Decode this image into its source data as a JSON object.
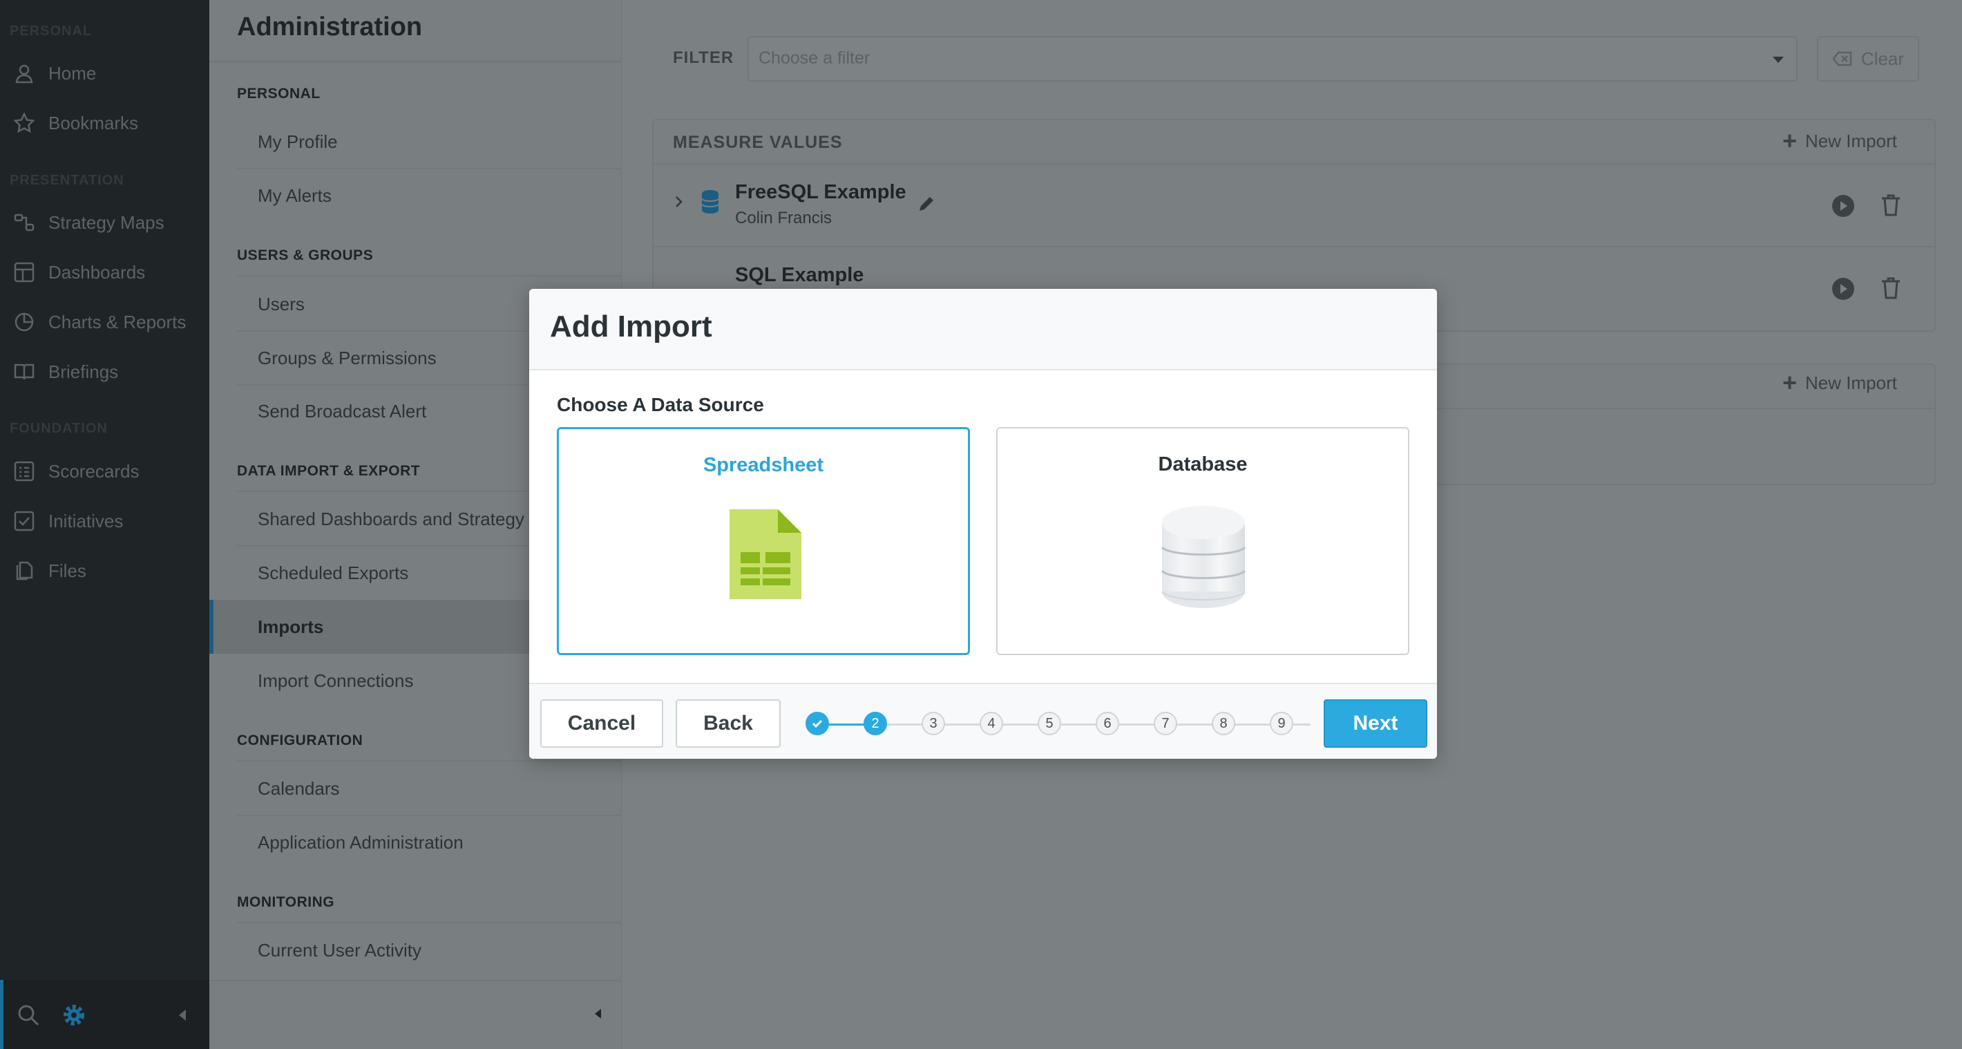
{
  "nav": {
    "sections": [
      "PERSONAL",
      "PRESENTATION",
      "FOUNDATION"
    ],
    "items": [
      {
        "label": "Home",
        "icon": "user-icon"
      },
      {
        "label": "Bookmarks",
        "icon": "star-icon"
      },
      {
        "label": "Strategy Maps",
        "icon": "strategy-map-icon"
      },
      {
        "label": "Dashboards",
        "icon": "dashboard-icon"
      },
      {
        "label": "Charts & Reports",
        "icon": "pie-chart-icon"
      },
      {
        "label": "Briefings",
        "icon": "book-icon"
      },
      {
        "label": "Scorecards",
        "icon": "scorecard-icon"
      },
      {
        "label": "Initiatives",
        "icon": "checkbox-icon"
      },
      {
        "label": "Files",
        "icon": "files-icon"
      }
    ],
    "bottom_icons": [
      "search-icon",
      "gear-icon",
      "collapse-left-icon"
    ],
    "accent_color": "#2aaadf"
  },
  "admin": {
    "title": "Administration",
    "sections": [
      {
        "title": "PERSONAL",
        "items": [
          "My Profile",
          "My Alerts"
        ]
      },
      {
        "title": "USERS & GROUPS",
        "items": [
          "Users",
          "Groups & Permissions",
          "Send Broadcast Alert"
        ]
      },
      {
        "title": "DATA IMPORT & EXPORT",
        "items": [
          "Shared Dashboards and Strategy Maps",
          "Scheduled Exports",
          "Imports",
          "Import Connections"
        ]
      },
      {
        "title": "CONFIGURATION",
        "items": [
          "Calendars",
          "Application Administration"
        ]
      },
      {
        "title": "MONITORING",
        "items": [
          "Current User Activity"
        ]
      }
    ],
    "active_item": "Imports"
  },
  "main": {
    "filter": {
      "label": "FILTER",
      "placeholder": "Choose a filter",
      "clear_label": "Clear"
    },
    "measure_values": {
      "title": "MEASURE VALUES",
      "new_import_label": "New Import",
      "rows": [
        {
          "name": "FreeSQL Example",
          "owner": "Colin Francis"
        },
        {
          "name": "SQL Example",
          "owner": ""
        }
      ]
    },
    "second_section": {
      "new_import_label": "New Import"
    }
  },
  "modal": {
    "title": "Add Import",
    "subtitle": "Choose A Data Source",
    "sources": [
      {
        "label": "Spreadsheet",
        "icon": "spreadsheet-icon",
        "selected": true
      },
      {
        "label": "Database",
        "icon": "database-icon",
        "selected": false
      }
    ],
    "cancel_label": "Cancel",
    "back_label": "Back",
    "next_label": "Next",
    "steps": [
      "",
      "2",
      "3",
      "4",
      "5",
      "6",
      "7",
      "8",
      "9"
    ],
    "current_step": 2,
    "colors": {
      "primary": "#2aaadf",
      "spreadsheet_green": "#a6cc32"
    }
  }
}
